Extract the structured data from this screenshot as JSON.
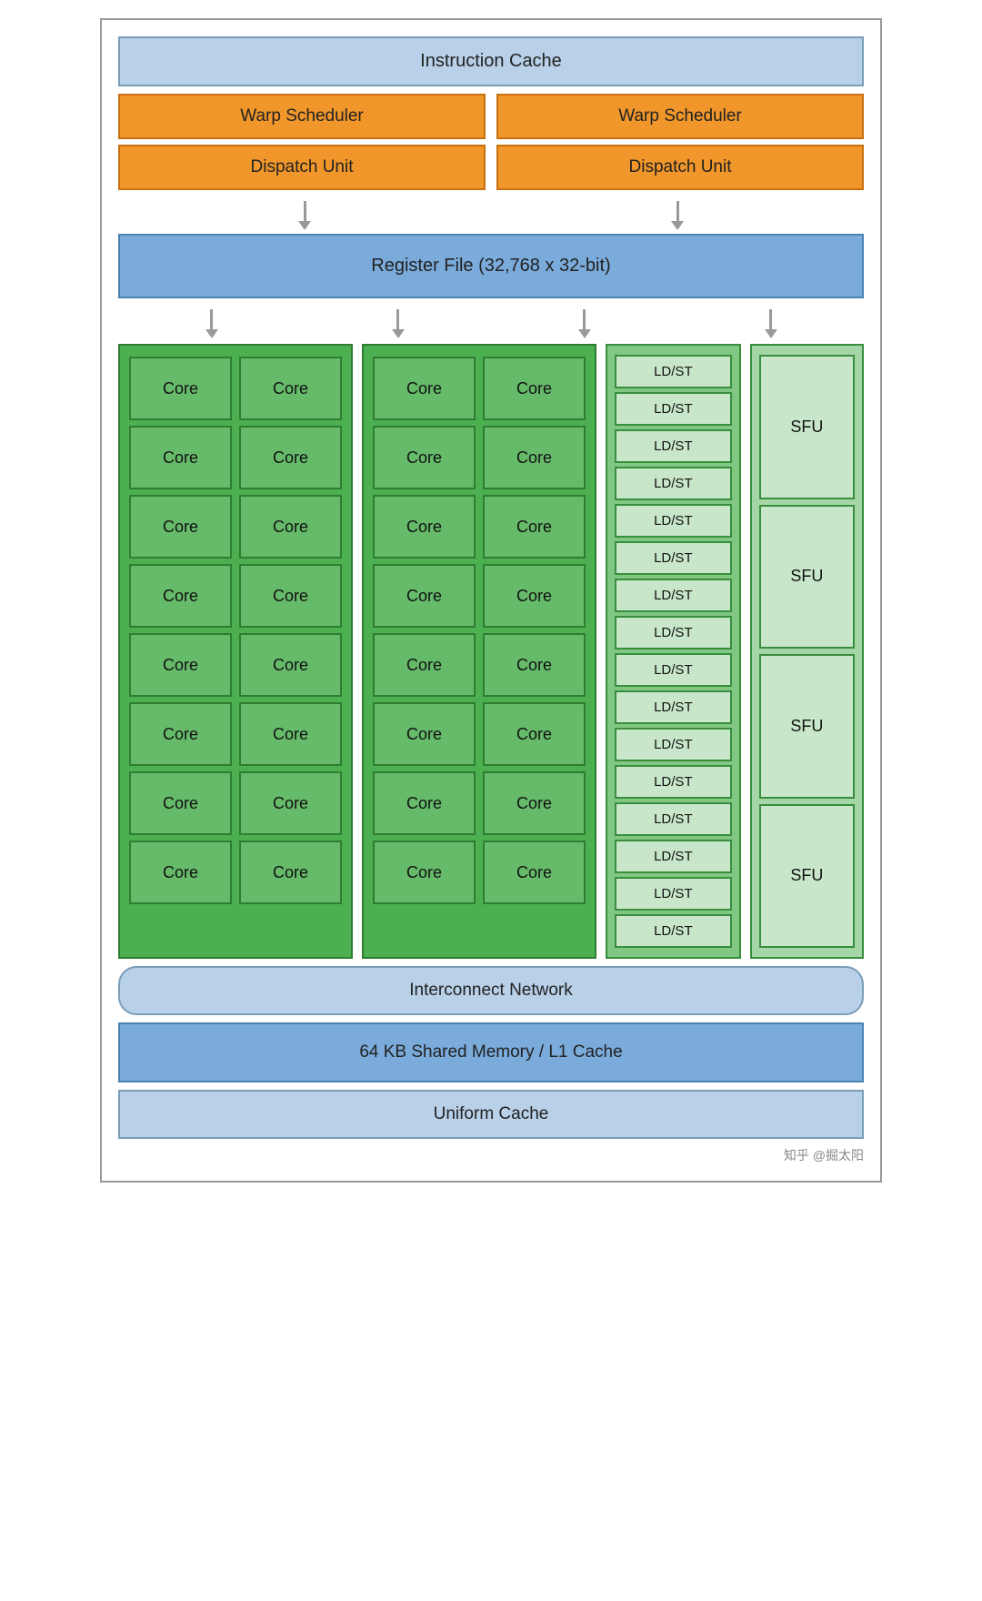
{
  "header": {
    "instruction_cache": "Instruction Cache"
  },
  "warp_section": {
    "warp_scheduler_left": "Warp Scheduler",
    "warp_scheduler_right": "Warp Scheduler",
    "dispatch_unit_left": "Dispatch Unit",
    "dispatch_unit_right": "Dispatch Unit"
  },
  "register_file": {
    "label": "Register File (32,768 x 32-bit)"
  },
  "cores": {
    "group1": {
      "rows": [
        [
          "Core",
          "Core"
        ],
        [
          "Core",
          "Core"
        ],
        [
          "Core",
          "Core"
        ],
        [
          "Core",
          "Core"
        ],
        [
          "Core",
          "Core"
        ],
        [
          "Core",
          "Core"
        ],
        [
          "Core",
          "Core"
        ],
        [
          "Core",
          "Core"
        ]
      ]
    },
    "group2": {
      "rows": [
        [
          "Core",
          "Core"
        ],
        [
          "Core",
          "Core"
        ],
        [
          "Core",
          "Core"
        ],
        [
          "Core",
          "Core"
        ],
        [
          "Core",
          "Core"
        ],
        [
          "Core",
          "Core"
        ],
        [
          "Core",
          "Core"
        ],
        [
          "Core",
          "Core"
        ]
      ]
    }
  },
  "ldst": {
    "units": [
      "LD/ST",
      "LD/ST",
      "LD/ST",
      "LD/ST",
      "LD/ST",
      "LD/ST",
      "LD/ST",
      "LD/ST",
      "LD/ST",
      "LD/ST",
      "LD/ST",
      "LD/ST",
      "LD/ST",
      "LD/ST",
      "LD/ST",
      "LD/ST"
    ]
  },
  "sfu": {
    "units": [
      "SFU",
      "SFU",
      "SFU",
      "SFU"
    ]
  },
  "interconnect": {
    "label": "Interconnect Network"
  },
  "shared_memory": {
    "label": "64 KB Shared Memory / L1 Cache"
  },
  "uniform_cache": {
    "label": "Uniform Cache"
  },
  "watermark": {
    "text": "知乎 @掘太阳"
  }
}
